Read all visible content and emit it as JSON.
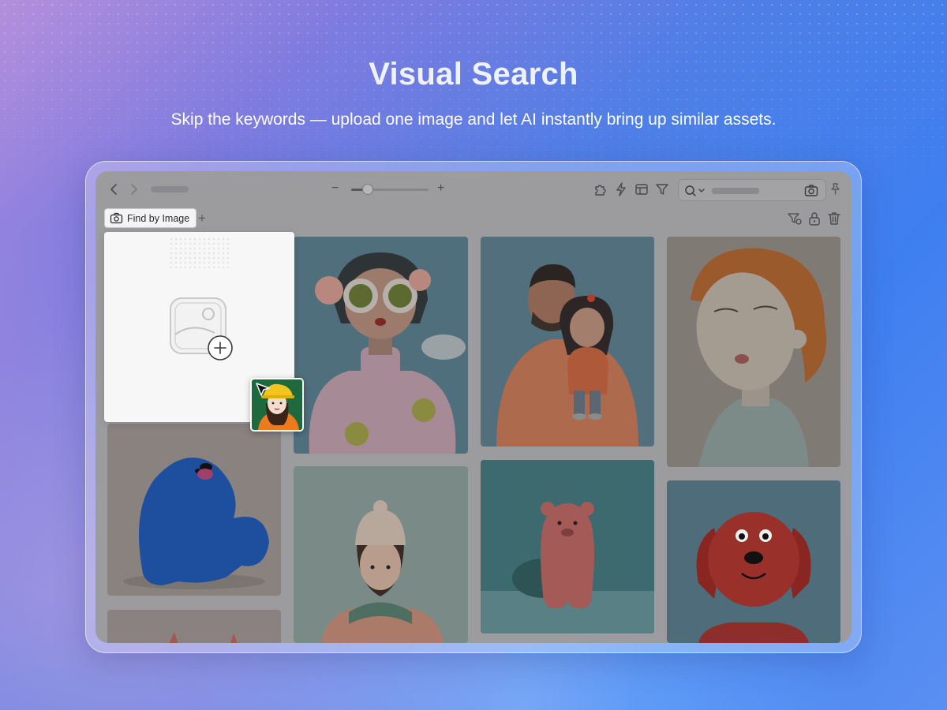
{
  "headline": "Visual Search",
  "subline": "Skip the keywords — upload one image and let AI instantly bring up similar assets.",
  "toolbar": {
    "back_icon": "chevron-left-icon",
    "forward_icon": "chevron-right-icon",
    "zoom_out_label": "−",
    "zoom_in_label": "+",
    "zoom_level": 0.2,
    "icons": [
      "puzzle-icon",
      "bolt-icon",
      "layout-icon",
      "filter-icon",
      "search-icon",
      "camera-search-icon",
      "pin-icon"
    ]
  },
  "tabs": {
    "find_by_image_label": "Find by Image",
    "add_tab_label": "+",
    "actions": [
      "filter-settings-icon",
      "lock-icon",
      "trash-icon"
    ]
  },
  "dropzone": {
    "icon": "image-add-icon"
  },
  "gallery": {
    "items": [
      "blue-furry-monster",
      "doll-with-sunglasses-and-flowers",
      "doll-in-beige-beanie",
      "man-holding-girl-doll",
      "pink-bear-figure",
      "sleeping-clay-woman",
      "red-dog-figure"
    ]
  },
  "colors": {
    "accent": "#3e7ff0",
    "overlay": "#9c9c9f"
  }
}
